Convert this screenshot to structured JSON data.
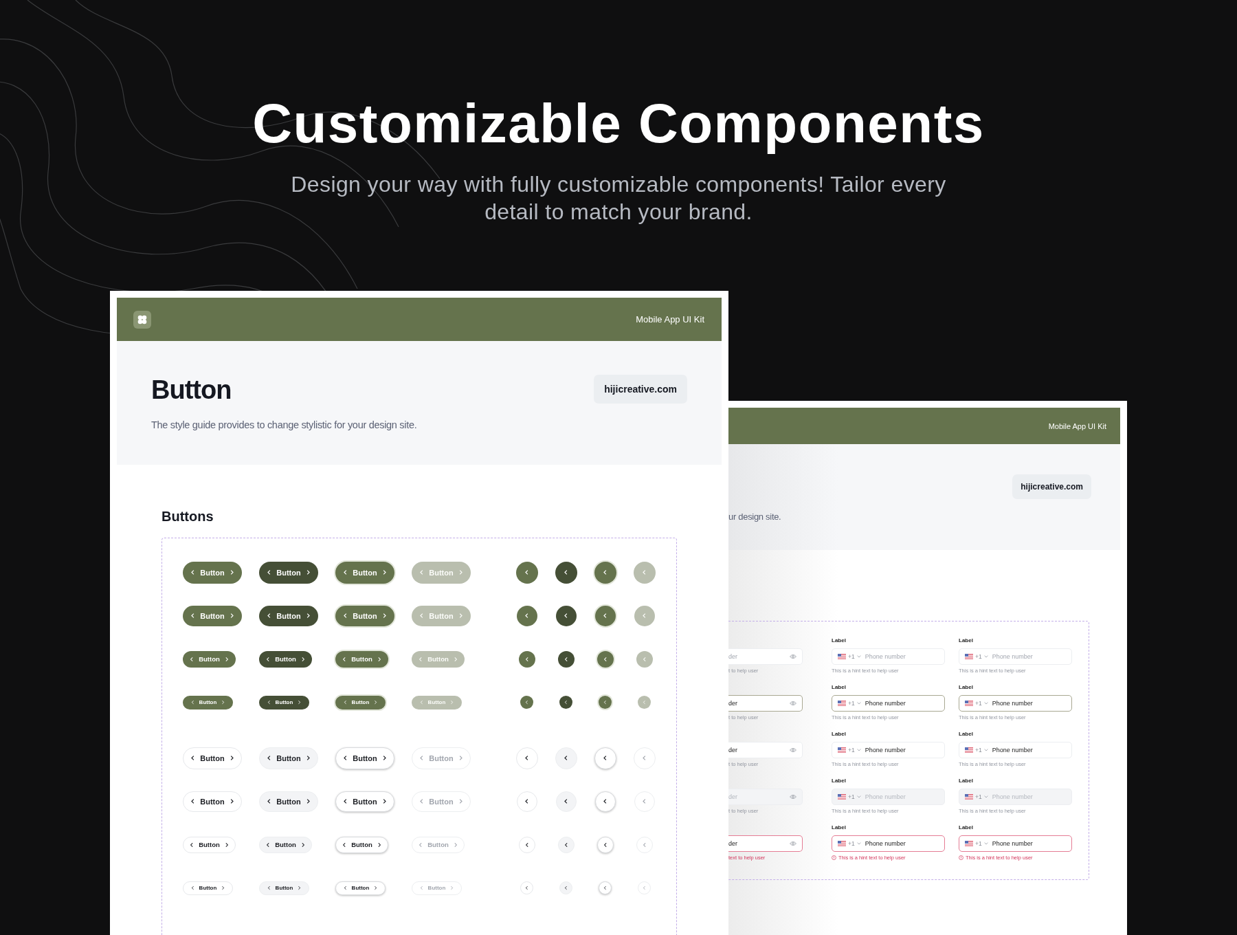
{
  "hero": {
    "title": "Customizable Components",
    "subtitle": "Design your way with fully customizable components! Tailor every detail to match your brand."
  },
  "left_card": {
    "header_title": "Mobile App UI Kit",
    "page_title": "Button",
    "description": "The style guide provides to change stylistic for your design site.",
    "website": "hijicreative.com",
    "section_title": "Buttons",
    "button_rows": [
      {
        "kind": "filled",
        "buttons": [
          {
            "label": "Button",
            "kind": "default"
          },
          {
            "label": "Button",
            "kind": "dark"
          },
          {
            "label": "Button",
            "kind": "focused"
          },
          {
            "label": "Button",
            "kind": "disabled"
          }
        ],
        "icon_buttons": [
          {
            "kind": "default"
          },
          {
            "kind": "dark"
          },
          {
            "kind": "focused"
          },
          {
            "kind": "disabled"
          }
        ]
      },
      {
        "kind": "filled",
        "buttons": [
          {
            "label": "Button",
            "kind": "default"
          },
          {
            "label": "Button",
            "kind": "dark"
          },
          {
            "label": "Button",
            "kind": "focused"
          },
          {
            "label": "Button",
            "kind": "disabled"
          }
        ],
        "icon_buttons": [
          {
            "kind": "default"
          },
          {
            "kind": "dark"
          },
          {
            "kind": "focused"
          },
          {
            "kind": "disabled"
          }
        ]
      },
      {
        "kind": "filled",
        "buttons": [
          {
            "label": "Button",
            "kind": "default"
          },
          {
            "label": "Button",
            "kind": "dark"
          },
          {
            "label": "Button",
            "kind": "focused"
          },
          {
            "label": "Button",
            "kind": "disabled"
          }
        ],
        "icon_buttons": [
          {
            "kind": "default"
          },
          {
            "kind": "dark"
          },
          {
            "kind": "focused"
          },
          {
            "kind": "disabled"
          }
        ]
      },
      {
        "kind": "filled",
        "buttons": [
          {
            "label": "Button",
            "kind": "default"
          },
          {
            "label": "Button",
            "kind": "dark"
          },
          {
            "label": "Button",
            "kind": "focused"
          },
          {
            "label": "Button",
            "kind": "disabled"
          }
        ],
        "icon_buttons": [
          {
            "kind": "default"
          },
          {
            "kind": "dark"
          },
          {
            "kind": "focused"
          },
          {
            "kind": "disabled"
          }
        ]
      },
      {
        "kind": "outline",
        "buttons": [
          {
            "label": "Button",
            "kind": "default"
          },
          {
            "label": "Button",
            "kind": "dark"
          },
          {
            "label": "Button",
            "kind": "focused"
          },
          {
            "label": "Button",
            "kind": "disabled"
          }
        ],
        "icon_buttons": [
          {
            "kind": "default"
          },
          {
            "kind": "dark"
          },
          {
            "kind": "focused"
          },
          {
            "kind": "disabled"
          }
        ]
      },
      {
        "kind": "outline",
        "buttons": [
          {
            "label": "Button",
            "kind": "default"
          },
          {
            "label": "Button",
            "kind": "dark"
          },
          {
            "label": "Button",
            "kind": "focused"
          },
          {
            "label": "Button",
            "kind": "disabled"
          }
        ],
        "icon_buttons": [
          {
            "kind": "default"
          },
          {
            "kind": "dark"
          },
          {
            "kind": "focused"
          },
          {
            "kind": "disabled"
          }
        ]
      },
      {
        "kind": "outline",
        "buttons": [
          {
            "label": "Button",
            "kind": "default"
          },
          {
            "label": "Button",
            "kind": "dark"
          },
          {
            "label": "Button",
            "kind": "focused"
          },
          {
            "label": "Button",
            "kind": "disabled"
          }
        ],
        "icon_buttons": [
          {
            "kind": "default"
          },
          {
            "kind": "dark"
          },
          {
            "kind": "focused"
          },
          {
            "kind": "disabled"
          }
        ]
      },
      {
        "kind": "outline",
        "buttons": [
          {
            "label": "Button",
            "kind": "default"
          },
          {
            "label": "Button",
            "kind": "dark"
          },
          {
            "label": "Button",
            "kind": "focused"
          },
          {
            "label": "Button",
            "kind": "disabled"
          }
        ],
        "icon_buttons": [
          {
            "kind": "default"
          },
          {
            "kind": "dark"
          },
          {
            "kind": "focused"
          },
          {
            "kind": "disabled"
          }
        ]
      }
    ]
  },
  "right_card": {
    "header_title": "Mobile App UI Kit",
    "website": "hijicreative.com",
    "description": "ur design site.",
    "field_rows": [
      {
        "kind": "default",
        "password": {
          "placeholder": "der",
          "hint": "t to help user"
        },
        "phones": [
          {
            "label": "Label",
            "code": "+1",
            "placeholder": "Phone number",
            "hint": "This is a hint text to help user"
          },
          {
            "label": "Label",
            "code": "+1",
            "placeholder": "Phone number",
            "hint": "This is a hint text to help user"
          }
        ]
      },
      {
        "kind": "focused",
        "password": {
          "value": "der",
          "hint": "t to help user"
        },
        "phones": [
          {
            "label": "Label",
            "code": "+1",
            "value": "Phone number",
            "hint": "This is a hint text to help user"
          },
          {
            "label": "Label",
            "code": "+1",
            "value": "Phone number",
            "hint": "This is a hint text to help user"
          }
        ]
      },
      {
        "kind": "filled",
        "password": {
          "value": "der",
          "hint": "t to help user"
        },
        "phones": [
          {
            "label": "Label",
            "code": "+1",
            "value": "Phone number",
            "hint": "This is a hint text to help user"
          },
          {
            "label": "Label",
            "code": "+1",
            "value": "Phone number",
            "hint": "This is a hint text to help user"
          }
        ]
      },
      {
        "kind": "disabled",
        "password": {
          "placeholder": "der",
          "hint": "t to help user"
        },
        "phones": [
          {
            "label": "Label",
            "code": "+1",
            "placeholder": "Phone number",
            "hint": "This is a hint text to help user"
          },
          {
            "label": "Label",
            "code": "+1",
            "placeholder": "Phone number",
            "hint": "This is a hint text to help user"
          }
        ]
      },
      {
        "kind": "error",
        "password": {
          "value": "der",
          "hint": "text to help user"
        },
        "phones": [
          {
            "label": "Label",
            "code": "+1",
            "value": "Phone number",
            "hint": "This is a hint text to help user"
          },
          {
            "label": "Label",
            "code": "+1",
            "value": "Phone number",
            "hint": "This is a hint text to help user"
          }
        ]
      }
    ]
  }
}
